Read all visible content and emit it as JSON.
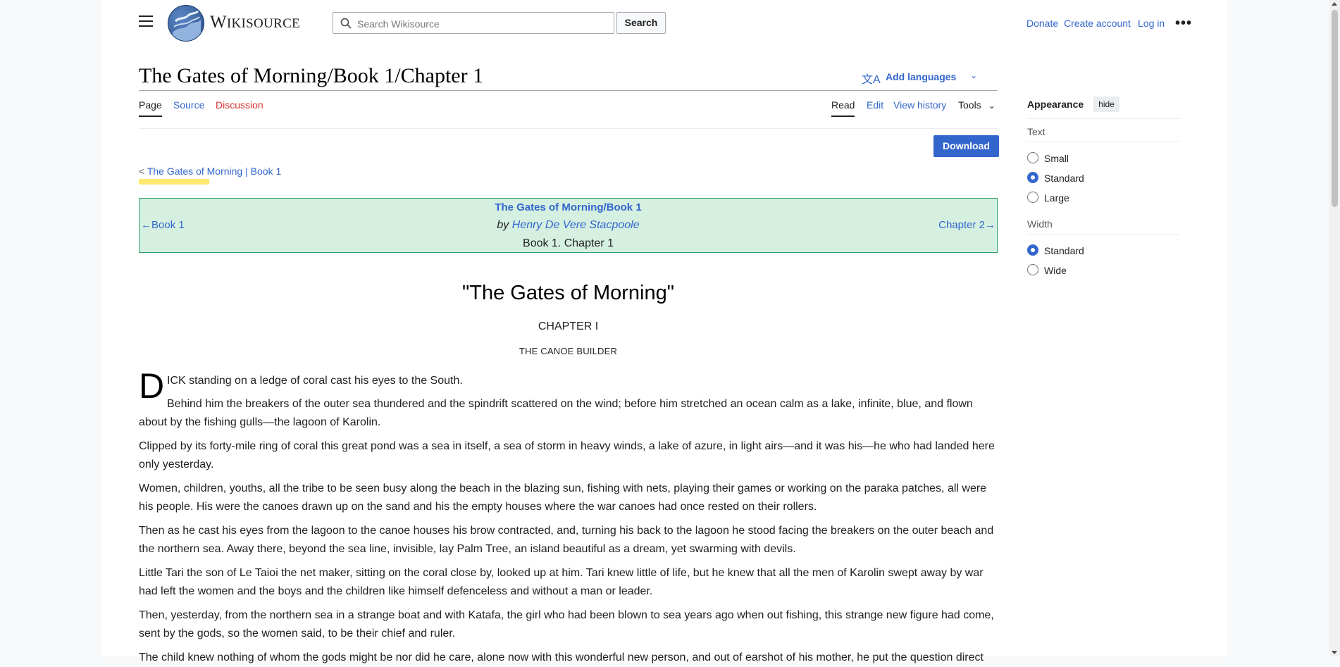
{
  "header": {
    "wordmark_first": "W",
    "wordmark_rest": "IKISOURCE",
    "search_placeholder": "Search Wikisource",
    "search_button": "Search",
    "user_links": [
      "Donate",
      "Create account",
      "Log in"
    ]
  },
  "page": {
    "title": "The Gates of Morning/Book 1/Chapter 1",
    "add_languages": "Add languages",
    "tabs_left": [
      "Page",
      "Source",
      "Discussion"
    ],
    "tabs_right": [
      "Read",
      "Edit",
      "View history",
      "Tools"
    ],
    "download": "Download",
    "breadcrumb_prefix": "< ",
    "breadcrumb_link1": "The Gates of Morning",
    "breadcrumb_sep": " | ",
    "breadcrumb_link2": "Book 1"
  },
  "header_box": {
    "work": "The Gates of Morning/Book 1",
    "by": "by ",
    "author": "Henry De Vere Stacpoole",
    "section": "Book 1. Chapter 1",
    "prev": "←Book 1",
    "next": "Chapter 2→",
    "bg_color": "#d5f0e1",
    "border_color": "#2ea06b"
  },
  "article": {
    "title": "\"The Gates of Morning\"",
    "chapter": "CHAPTER I",
    "subtitle": "THE CANOE BUILDER",
    "dropcap": "D",
    "first_line": "ICK standing on a ledge of coral cast his eyes to the South.",
    "p1a": "Behind him the breakers of the outer sea thundered and the spindrift scattered on the wind; before him stretched an ocean calm as a lake, infinite, blue, and flown",
    "p1b": "about by the fishing gulls—the lagoon of Karolin.",
    "p2": "Clipped by its forty-mile ring of coral this great pond was a sea in itself, a sea of storm in heavy winds, a lake of azure, in light airs—and it was his—he who had landed here only yesterday.",
    "p3": "Women, children, youths, all the tribe to be seen busy along the beach in the blazing sun, fishing with nets, playing their games or working on the paraka patches, all were his people. His were the canoes drawn up on the sand and his the empty houses where the war canoes had once rested on their rollers.",
    "p4": "Then as he cast his eyes from the lagoon to the canoe houses his brow contracted, and, turning his back to the lagoon he stood facing the breakers on the outer beach and the northern sea. Away there, beyond the sea line, invisible, lay Palm Tree, an island beautiful as a dream, yet swarming with devils.",
    "p5": "Little Tari the son of Le Taioi the net maker, sitting on the coral close by, looked up at him. Tari knew little of life, but he knew that all the men of Karolin swept away by war had left the women and the boys and the children like himself defenceless and without a man or leader.",
    "p6": "Then, yesterday, from the northern sea in a strange boat and with Katafa, the girl who had been blown to sea years ago when out fishing, this strange new figure had come, sent by the gods, so the women said, to be their chief and ruler.",
    "p7": "The child knew nothing of whom the gods might be nor did he care, alone now with this wonderful new person, and out of earshot of his mother, he put the question direct"
  },
  "appearance": {
    "heading": "Appearance",
    "hide": "hide",
    "text_label": "Text",
    "text_options": [
      "Small",
      "Standard",
      "Large"
    ],
    "text_selected": "Standard",
    "width_label": "Width",
    "width_options": [
      "Standard",
      "Wide"
    ],
    "width_selected": "Standard"
  },
  "colors": {
    "link": "#3366cc",
    "new_link": "#d73333",
    "accent": "#3366cc",
    "highlight": "#fde870"
  }
}
